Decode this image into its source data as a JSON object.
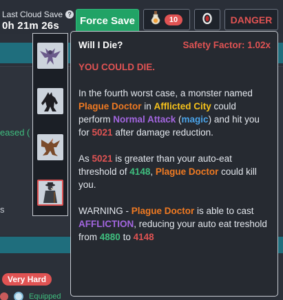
{
  "topbar": {
    "cloud_label": "Last Cloud Save",
    "cloud_help_icon": "?",
    "cloud_time": "0h 21m 26s",
    "force_save_label": "Force Save",
    "potion_count": "10",
    "danger_label": "DANGER"
  },
  "background": {
    "released_text": "eased (",
    "stub_text": "s",
    "difficulty_badge": "Very Hard",
    "equipped_label": "Equipped"
  },
  "monsters": [
    {
      "name": "winged-demon-icon"
    },
    {
      "name": "werewolf-icon"
    },
    {
      "name": "dragon-icon"
    },
    {
      "name": "plague-doctor-icon",
      "selected": true
    }
  ],
  "tooltip": {
    "title": "Will I Die?",
    "safety_factor": "Safety Factor: 1.02x",
    "verdict": "YOU COULD DIE.",
    "p1": {
      "t1": "In the fourth worst case, a monster named ",
      "monster": "Plague Doctor",
      "t2": " in ",
      "area": "Afflicted City",
      "t3": " could perform ",
      "attack": "Normal Attack",
      "t4": " (",
      "attack_type": "magic",
      "t5": ") and hit you for ",
      "damage": "5021",
      "t6": " after damage reduction."
    },
    "p2": {
      "t1": "As ",
      "damage": "5021",
      "t2": " is greater than your auto-eat threshold of ",
      "threshold": "4148",
      "t3": ", ",
      "monster": "Plague Doctor",
      "t4": " could kill you."
    },
    "p3": {
      "t1": "WARNING - ",
      "monster": "Plague Doctor",
      "t2": " is able to cast ",
      "spell": "AFFLICTION",
      "t3": ", reducing your auto eat treshold from ",
      "old_threshold": "4880",
      "t4": " to ",
      "new_threshold": "4148"
    }
  },
  "colors": {
    "force_save": "#21a366",
    "danger": "#e05353",
    "monster_name": "#f07a22",
    "area": "#f6c21b",
    "attack": "#a366e0",
    "attack_type": "#4aa3e8",
    "threshold": "#3fbf7f",
    "teal_band": "#1f6e7d"
  }
}
